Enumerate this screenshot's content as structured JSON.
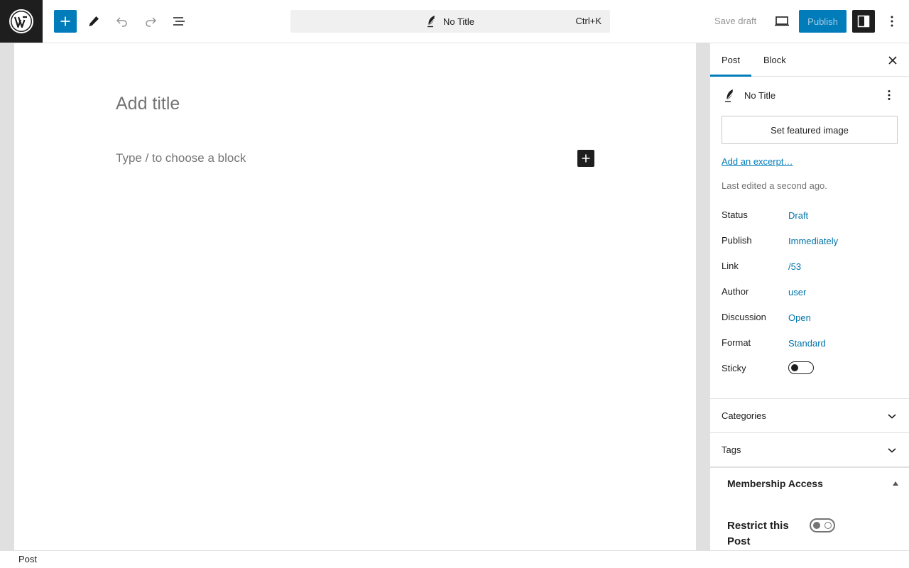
{
  "colors": {
    "accent": "#007cba",
    "dark": "#1e1e1e",
    "link": "#0073aa"
  },
  "toolbar": {
    "command_title": "No Title",
    "command_shortcut": "Ctrl+K",
    "save_draft_label": "Save draft",
    "publish_label": "Publish"
  },
  "editor": {
    "title_placeholder": "Add title",
    "block_placeholder": "Type / to choose a block"
  },
  "sidebar": {
    "tabs": [
      {
        "label": "Post",
        "active": true
      },
      {
        "label": "Block",
        "active": false
      }
    ],
    "post_title": "No Title",
    "featured_image_label": "Set featured image",
    "excerpt_link": "Add an excerpt…",
    "last_edited": "Last edited a second ago.",
    "meta": [
      {
        "label": "Status",
        "value": "Draft"
      },
      {
        "label": "Publish",
        "value": "Immediately"
      },
      {
        "label": "Link",
        "value": "/53"
      },
      {
        "label": "Author",
        "value": "user"
      },
      {
        "label": "Discussion",
        "value": "Open"
      },
      {
        "label": "Format",
        "value": "Standard"
      }
    ],
    "sticky_label": "Sticky",
    "sticky_on": false,
    "panels": [
      {
        "label": "Categories"
      },
      {
        "label": "Tags"
      }
    ],
    "membership": {
      "title": "Membership Access",
      "restrict_label": "Restrict this Post",
      "restrict_on": false
    }
  },
  "footer": {
    "breadcrumb": "Post"
  }
}
